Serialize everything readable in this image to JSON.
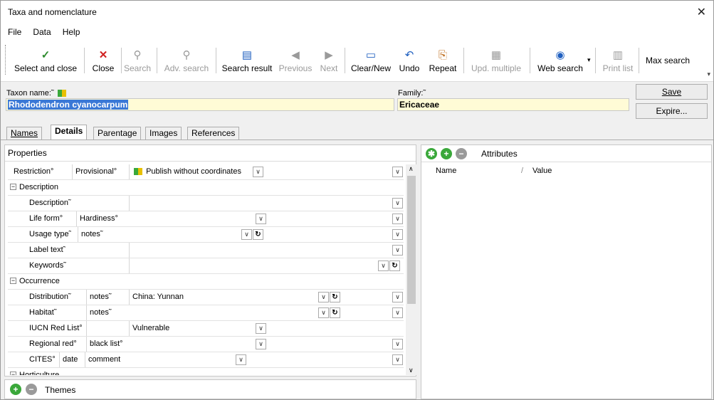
{
  "window": {
    "title": "Taxa and nomenclature",
    "close_glyph": "✕"
  },
  "menu": [
    "File",
    "Data",
    "Help"
  ],
  "toolbar": {
    "buttons": [
      {
        "label": "Select and close",
        "icon": "check-icon",
        "glyph": "✓",
        "color": "#2e8b2e",
        "enabled": true
      },
      {
        "label": "Close",
        "icon": "close-icon",
        "glyph": "✕",
        "color": "#d02020",
        "enabled": true
      },
      {
        "label": "Search",
        "icon": "binoculars-icon",
        "glyph": "⚲",
        "color": "#9a9a9a",
        "enabled": false
      },
      {
        "label": "Adv. search",
        "icon": "binoculars-plus-icon",
        "glyph": "⚲",
        "color": "#9a9a9a",
        "enabled": false
      },
      {
        "label": "Search result",
        "icon": "table-icon",
        "glyph": "▤",
        "color": "#2060c0",
        "enabled": true
      },
      {
        "label": "Previous",
        "icon": "previous-icon",
        "glyph": "◀",
        "color": "#9a9a9a",
        "enabled": false
      },
      {
        "label": "Next",
        "icon": "next-icon",
        "glyph": "▶",
        "color": "#9a9a9a",
        "enabled": false
      },
      {
        "label": "Clear/New",
        "icon": "new-window-icon",
        "glyph": "▭",
        "color": "#2060c0",
        "enabled": true
      },
      {
        "label": "Undo",
        "icon": "undo-icon",
        "glyph": "↶",
        "color": "#2060c0",
        "enabled": true
      },
      {
        "label": "Repeat",
        "icon": "repeat-icon",
        "glyph": "⎘",
        "color": "#c07020",
        "enabled": true
      },
      {
        "label": "Upd. multiple",
        "icon": "update-multiple-icon",
        "glyph": "▦",
        "color": "#9a9a9a",
        "enabled": false
      },
      {
        "label": "Web search",
        "icon": "web-search-icon",
        "glyph": "◉",
        "color": "#2060c0",
        "enabled": true
      },
      {
        "label": "Print list",
        "icon": "print-icon",
        "glyph": "▥",
        "color": "#9a9a9a",
        "enabled": false
      },
      {
        "label": "Max search",
        "icon": "",
        "glyph": "",
        "color": "#000000",
        "enabled": true
      }
    ],
    "web_search_dropdown": "▾",
    "overflow": "▾"
  },
  "header": {
    "taxon_label": "Taxon name:˜",
    "taxon_value": "Rhododendron cyanocarpum",
    "family_label": "Family:˜",
    "family_value": "Ericaceae",
    "save_label": "Save",
    "expire_label": "Expire..."
  },
  "tabs": [
    "Names",
    "Details",
    "Parentage",
    "Images",
    "References"
  ],
  "active_tab": "Details",
  "properties": {
    "title": "Properties",
    "restriction": {
      "label": "Restriction°",
      "sub": "Provisional°",
      "value": "Publish without coordinates"
    },
    "description_section": "Description",
    "description": "Description˜",
    "life_form": "Life form°",
    "hardiness": "Hardiness°",
    "usage_type": "Usage type˜",
    "usage_notes": "notes˜",
    "label_text": "Label text˜",
    "keywords": "Keywords˜",
    "occurrence_section": "Occurrence",
    "distribution": {
      "label": "Distribution˜",
      "sub": "notes˜",
      "value": "China: Yunnan"
    },
    "habitat": {
      "label": "Habitat˜",
      "sub": "notes˜"
    },
    "iucn": {
      "label": "IUCN Red List°",
      "value": "Vulnerable"
    },
    "regional": {
      "label": "Regional red°",
      "sub": "black list°"
    },
    "cites": {
      "label": "CITES°",
      "sub": "date",
      "sub2": "comment"
    },
    "horticulture_section": "Horticulture"
  },
  "themes": {
    "label": "Themes"
  },
  "attributes": {
    "title": "Attributes",
    "col_name": "Name",
    "col_value": "Value"
  },
  "colors": {
    "field_bg": "#fffbd6",
    "selection": "#3a78d6",
    "add_green": "#3aa83a",
    "remove_gray": "#9a9a9a"
  }
}
